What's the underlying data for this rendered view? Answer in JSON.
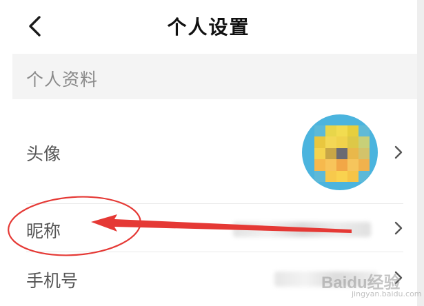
{
  "header": {
    "title": "个人设置",
    "back_icon": "chevron-left-icon"
  },
  "section": {
    "label": "个人资料"
  },
  "rows": {
    "avatar": {
      "label": "头像",
      "value": "blurred-avatar-image"
    },
    "nickname": {
      "label": "昵称",
      "value": "blurred"
    },
    "phone": {
      "label": "手机号",
      "value": "blurred"
    }
  },
  "annotation": {
    "color": "#e53935",
    "target": "昵称"
  },
  "watermark": {
    "brand": "Baidu经验",
    "domain": "jingyan.baidu.com"
  },
  "colors": {
    "avatar_bg": "#4bb4de",
    "section_bg": "#f4f4f4",
    "chevron": "#555555"
  }
}
